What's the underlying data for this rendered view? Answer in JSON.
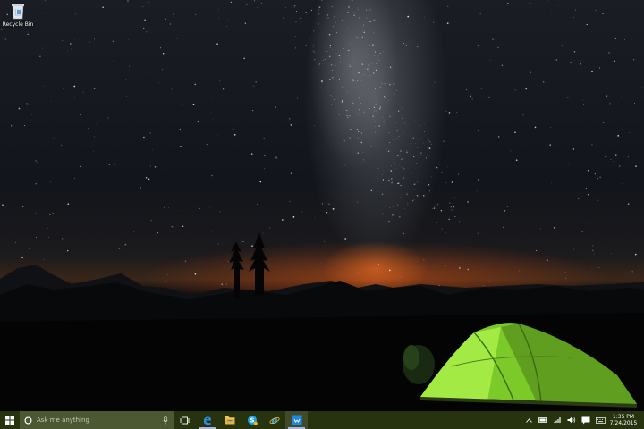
{
  "desktop": {
    "icons": [
      {
        "label": "Recycle Bin",
        "icon": "recycle-bin-icon"
      }
    ]
  },
  "taskbar": {
    "start_icon": "windows-logo-icon",
    "search": {
      "placeholder": "Ask me anything",
      "icon": "cortana-icon",
      "mic_icon": "microphone-icon"
    },
    "buttons": [
      {
        "name": "task-view",
        "icon": "task-view-icon"
      },
      {
        "name": "edge",
        "icon": "edge-icon",
        "running": true
      },
      {
        "name": "file-explorer",
        "icon": "folder-icon"
      },
      {
        "name": "skype",
        "icon": "skype-icon"
      },
      {
        "name": "internet-explorer",
        "icon": "ie-icon"
      },
      {
        "name": "store",
        "icon": "store-icon",
        "running": true,
        "active": true
      }
    ],
    "tray": {
      "icons": [
        "chevron-up-icon",
        "battery-icon",
        "network-icon",
        "volume-icon",
        "action-center-icon",
        "keyboard-icon"
      ]
    },
    "clock": {
      "time": "1:35 PM",
      "date": "7/24/2015"
    }
  },
  "colors": {
    "taskbar": "#27330f",
    "search_box": "#4c5832",
    "accent": "#1e88e5",
    "tent": "#9be43a"
  }
}
